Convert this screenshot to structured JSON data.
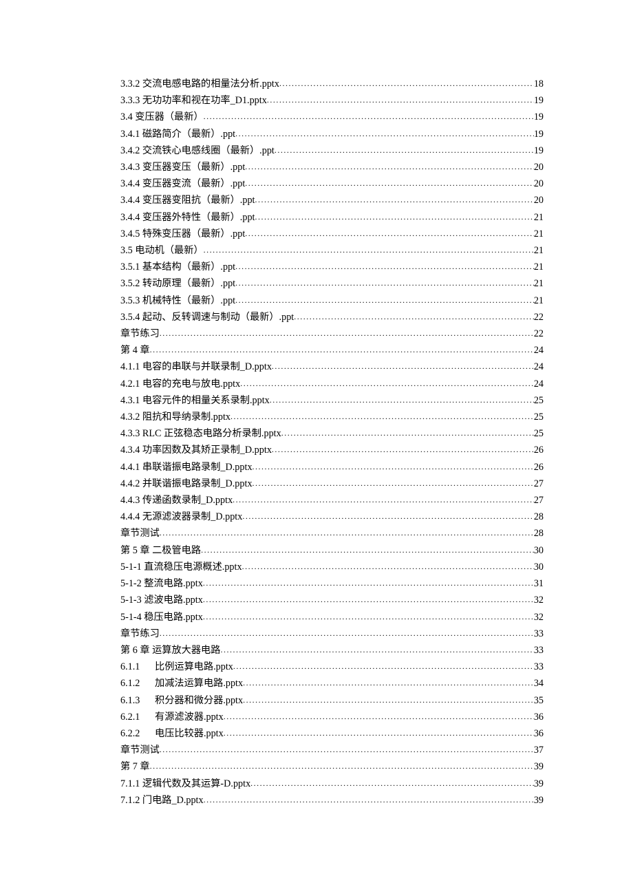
{
  "toc": [
    {
      "label": "3.3.2  交流电感电路的相量法分析.pptx",
      "page": "18",
      "indent": false
    },
    {
      "label": "3.3.3  无功功率和视在功率_D1.pptx",
      "page": "19",
      "indent": false
    },
    {
      "label": "3.4 变压器（最新）",
      "page": "19",
      "indent": false
    },
    {
      "label": "3.4.1  磁路简介（最新）.ppt",
      "page": "19",
      "indent": false
    },
    {
      "label": "3.4.2  交流铁心电感线圈（最新）.ppt",
      "page": "19",
      "indent": false
    },
    {
      "label": "3.4.3  变压器变压（最新）.ppt",
      "page": "20",
      "indent": false
    },
    {
      "label": "3.4.4  变压器变流（最新）.ppt",
      "page": "20",
      "indent": false
    },
    {
      "label": "3.4.4  变压器变阻抗（最新）.ppt",
      "page": "20",
      "indent": false
    },
    {
      "label": "3.4.4  变压器外特性（最新）.ppt",
      "page": "21",
      "indent": false
    },
    {
      "label": "3.4.5  特殊变压器（最新）.ppt",
      "page": "21",
      "indent": false
    },
    {
      "label": "3.5 电动机（最新）",
      "page": "21",
      "indent": false
    },
    {
      "label": "3.5.1  基本结构（最新）.ppt",
      "page": "21",
      "indent": false
    },
    {
      "label": "3.5.2  转动原理（最新）.ppt",
      "page": "21",
      "indent": false
    },
    {
      "label": "3.5.3  机械特性（最新）.ppt",
      "page": "21",
      "indent": false
    },
    {
      "label": "3.5.4  起动、反转调速与制动（最新）.ppt",
      "page": "22",
      "indent": false
    },
    {
      "label": "章节练习",
      "page": "22",
      "indent": false
    },
    {
      "label": "第 4 章",
      "page": "24",
      "indent": false
    },
    {
      "label": "4.1.1  电容的串联与并联录制_D.pptx",
      "page": "24",
      "indent": false
    },
    {
      "label": "4.2.1  电容的充电与放电.pptx",
      "page": "24",
      "indent": false
    },
    {
      "label": "4.3.1  电容元件的相量关系录制.pptx",
      "page": "25",
      "indent": false
    },
    {
      "label": "4.3.2  阻抗和导纳录制.pptx",
      "page": "25",
      "indent": false
    },
    {
      "label": "4.3.3 RLC 正弦稳态电路分析录制.pptx",
      "page": "25",
      "indent": false
    },
    {
      "label": "4.3.4  功率因数及其矫正录制_D.pptx",
      "page": "26",
      "indent": false
    },
    {
      "label": "4.4.1  串联谐振电路录制_D.pptx",
      "page": "26",
      "indent": false
    },
    {
      "label": "4.4.2  并联谐振电路录制_D.pptx",
      "page": "27",
      "indent": false
    },
    {
      "label": "4.4.3  传递函数录制_D.pptx",
      "page": "27",
      "indent": false
    },
    {
      "label": "4.4.4  无源滤波器录制_D.pptx",
      "page": "28",
      "indent": false
    },
    {
      "label": "章节测试",
      "page": "28",
      "indent": false
    },
    {
      "label": "第 5 章  二极管电路",
      "page": "30",
      "indent": false
    },
    {
      "label": "5-1-1  直流稳压电源概述.pptx",
      "page": "30",
      "indent": false
    },
    {
      "label": "5-1-2  整流电路.pptx",
      "page": "31",
      "indent": false
    },
    {
      "label": "5-1-3  滤波电路.pptx",
      "page": "32",
      "indent": false
    },
    {
      "label": "5-1-4  稳压电路.pptx",
      "page": "32",
      "indent": false
    },
    {
      "label": "章节练习",
      "page": "33",
      "indent": false
    },
    {
      "label": "第 6 章  运算放大器电路",
      "page": "33",
      "indent": false
    },
    {
      "label": "6.1.1",
      "label2": "比例运算电路.pptx",
      "page": "33",
      "indent": true
    },
    {
      "label": "6.1.2",
      "label2": "加减法运算电路.pptx",
      "page": "34",
      "indent": true
    },
    {
      "label": "6.1.3",
      "label2": "积分器和微分器.pptx",
      "page": "35",
      "indent": true
    },
    {
      "label": "6.2.1",
      "label2": "有源滤波器.pptx",
      "page": "36",
      "indent": true
    },
    {
      "label": "6.2.2",
      "label2": "电压比较器.pptx",
      "page": "36",
      "indent": true
    },
    {
      "label": "章节测试",
      "page": "37",
      "indent": false
    },
    {
      "label": "第 7 章",
      "page": "39",
      "indent": false
    },
    {
      "label": "7.1.1  逻辑代数及其运算-D.pptx",
      "page": "39",
      "indent": false
    },
    {
      "label": "7.1.2  门电路_D.pptx",
      "page": "39",
      "indent": false
    }
  ]
}
